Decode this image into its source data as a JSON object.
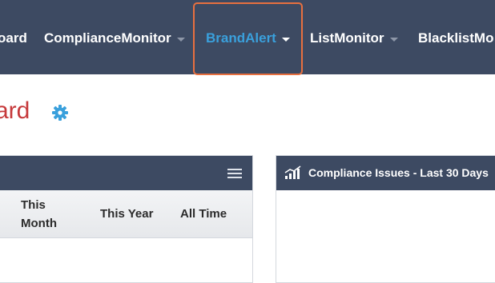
{
  "nav": {
    "items": [
      {
        "label": "oard",
        "has_caret": false
      },
      {
        "label": "ComplianceMonitor",
        "has_caret": true
      },
      {
        "label": "BrandAlert",
        "has_caret": true,
        "active": true
      },
      {
        "label": "ListMonitor",
        "has_caret": true
      },
      {
        "label": "BlacklistMo",
        "has_caret": false
      }
    ]
  },
  "page": {
    "title": "ard",
    "settings_icon": "gear-icon"
  },
  "left_panel": {
    "menu_icon": "hamburger-menu-icon",
    "columns": [
      "This\nMonth",
      "This Year",
      "All Time"
    ]
  },
  "right_panel": {
    "icon": "bar-chart-icon",
    "title": "Compliance Issues - Last 30 Days"
  },
  "colors": {
    "navbar": "#3d4a62",
    "active_link": "#3aa0dc",
    "title": "#c6393b",
    "highlight": "#e8703f"
  }
}
